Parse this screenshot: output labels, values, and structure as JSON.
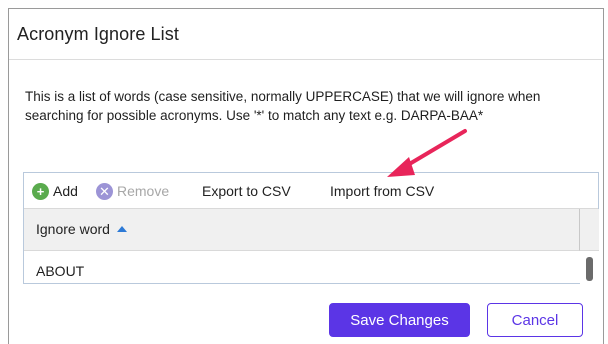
{
  "dialog": {
    "title": "Acronym Ignore List",
    "description": "This is a list of words (case sensitive, normally UPPERCASE) that we will ignore when searching for possible acronyms. Use '*' to match any text e.g. DARPA-BAA*"
  },
  "toolbar": {
    "add_label": "Add",
    "remove_label": "Remove",
    "export_label": "Export to CSV",
    "import_label": "Import from CSV"
  },
  "grid": {
    "column_header": "Ignore word",
    "sort": "ascending",
    "rows": [
      "ABOUT"
    ]
  },
  "footer": {
    "save_label": "Save Changes",
    "cancel_label": "Cancel"
  },
  "colors": {
    "primary": "#5b35e6",
    "add_icon": "#5aab4e",
    "remove_icon": "#9c94d6",
    "annotation_arrow": "#e8255a",
    "sort_arrow": "#2d7ad6"
  }
}
